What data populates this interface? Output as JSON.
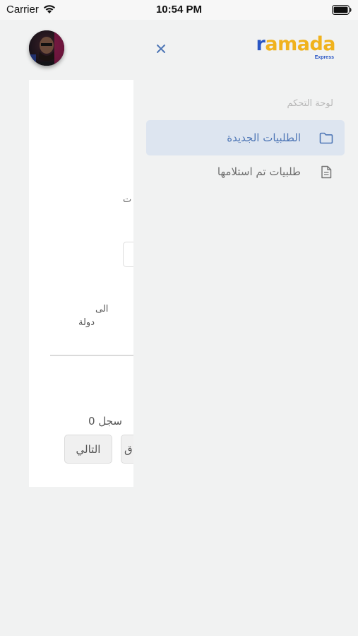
{
  "status_bar": {
    "carrier": "Carrier",
    "time": "10:54 PM",
    "wifi_icon": "wifi-icon",
    "battery_icon": "battery-icon"
  },
  "background_page": {
    "fragment_label": "ت",
    "column_header_line1": "الى",
    "column_header_line2": "دولة",
    "records_text": "0 سجل",
    "next_button_label": "التالي",
    "prev_button_fragment": "ق"
  },
  "sidebar": {
    "close_icon": "close-icon",
    "logo": {
      "text_accent": "r",
      "text_main": "amada",
      "subtitle": "Express"
    },
    "section_title": "لوحة التحكم",
    "items": [
      {
        "label": "الطلبيات الجديدة",
        "icon": "folder-icon",
        "active": true
      },
      {
        "label": "طلبيات تم استلامها",
        "icon": "document-icon",
        "active": false
      }
    ]
  },
  "colors": {
    "accent": "#4f77b6",
    "active_bg": "#dde5f0",
    "logo_blue": "#2a56c4",
    "logo_yellow": "#f0b21d",
    "background": "#f1f2f2"
  }
}
